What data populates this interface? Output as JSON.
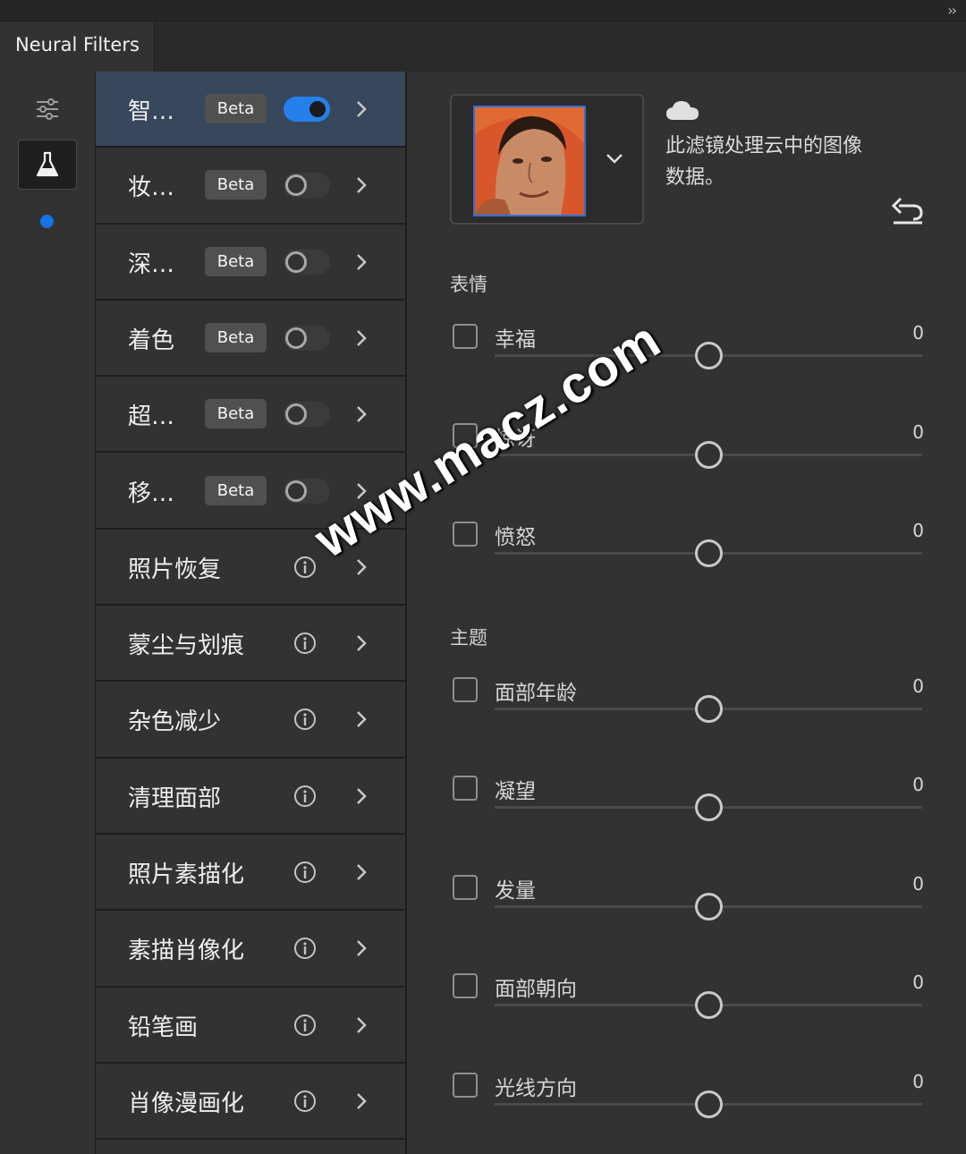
{
  "window": {
    "collapse_icon": "double-chevron-right-icon",
    "tab_title": "Neural Filters"
  },
  "rail": {
    "icons": [
      "sliders-icon",
      "flask-icon"
    ],
    "indicator_color": "#1473e6"
  },
  "filters": [
    {
      "label": "智…",
      "badge": "Beta",
      "toggle": true,
      "active": true
    },
    {
      "label": "妆…",
      "badge": "Beta",
      "toggle": false
    },
    {
      "label": "深…",
      "badge": "Beta",
      "toggle": false
    },
    {
      "label": "着色",
      "badge": "Beta",
      "toggle": false
    },
    {
      "label": "超…",
      "badge": "Beta",
      "toggle": false
    },
    {
      "label": "移…",
      "badge": "Beta",
      "toggle": false
    },
    {
      "label": "照片恢复",
      "info": true
    },
    {
      "label": "蒙尘与划痕",
      "info": true
    },
    {
      "label": "杂色减少",
      "info": true
    },
    {
      "label": "清理面部",
      "info": true
    },
    {
      "label": "照片素描化",
      "info": true
    },
    {
      "label": "素描肖像化",
      "info": true
    },
    {
      "label": "铅笔画",
      "info": true
    },
    {
      "label": "肖像漫画化",
      "info": true
    }
  ],
  "detail": {
    "cloud_text": "此滤镜处理云中的图像数据。",
    "sections": [
      {
        "title": "表情",
        "sliders": [
          {
            "label": "幸福",
            "value": "0"
          },
          {
            "label": "惊讶",
            "value": "0"
          },
          {
            "label": "愤怒",
            "value": "0"
          }
        ]
      },
      {
        "title": "主题",
        "sliders": [
          {
            "label": "面部年龄",
            "value": "0"
          },
          {
            "label": "凝望",
            "value": "0"
          },
          {
            "label": "发量",
            "value": "0"
          },
          {
            "label": "面部朝向",
            "value": "0"
          },
          {
            "label": "光线方向",
            "value": "0"
          }
        ]
      }
    ]
  },
  "watermark": "www.macz.com",
  "colors": {
    "accent": "#2680eb",
    "active_row": "#37475c",
    "panel": "#323232"
  }
}
